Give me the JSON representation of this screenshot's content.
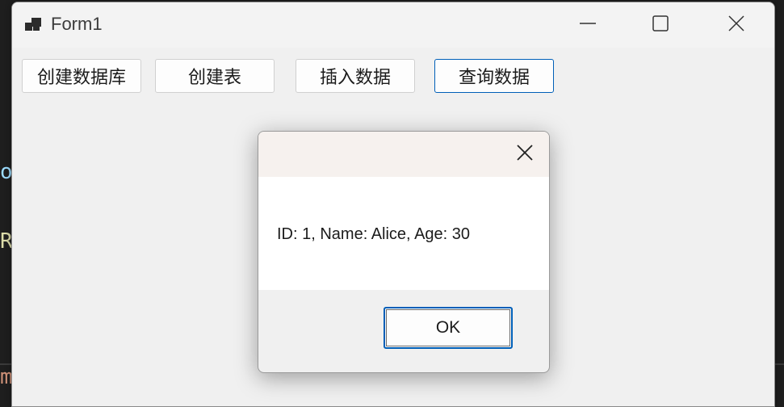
{
  "window": {
    "title": "Form1"
  },
  "form_buttons": {
    "create_db": "创建数据库",
    "create_table": "创建表",
    "insert_data": "插入数据",
    "query_data": "查询数据"
  },
  "dialog": {
    "message": "ID: 1, Name: Alice, Age: 30",
    "ok_label": "OK"
  },
  "editor_background": {
    "fragments": [
      "o",
      "R",
      "m"
    ]
  },
  "colors": {
    "accent": "#005fb8",
    "editor_bg": "#1e1e1e",
    "window_bg": "#f0f0f0"
  }
}
